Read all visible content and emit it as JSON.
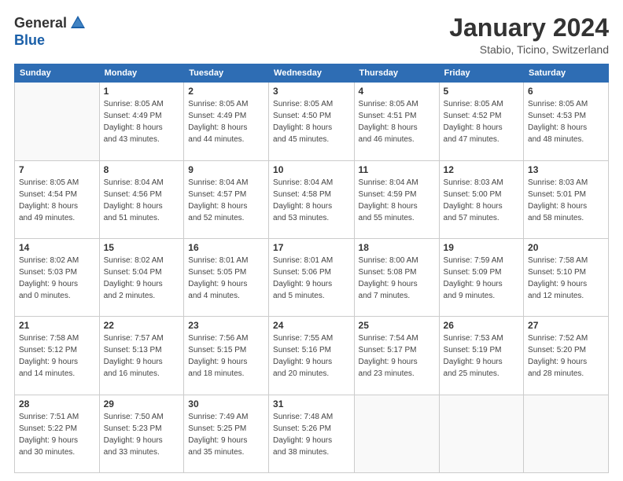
{
  "logo": {
    "general": "General",
    "blue": "Blue"
  },
  "title": "January 2024",
  "location": "Stabio, Ticino, Switzerland",
  "days_header": [
    "Sunday",
    "Monday",
    "Tuesday",
    "Wednesday",
    "Thursday",
    "Friday",
    "Saturday"
  ],
  "weeks": [
    [
      {
        "day": "",
        "info": ""
      },
      {
        "day": "1",
        "info": "Sunrise: 8:05 AM\nSunset: 4:49 PM\nDaylight: 8 hours\nand 43 minutes."
      },
      {
        "day": "2",
        "info": "Sunrise: 8:05 AM\nSunset: 4:49 PM\nDaylight: 8 hours\nand 44 minutes."
      },
      {
        "day": "3",
        "info": "Sunrise: 8:05 AM\nSunset: 4:50 PM\nDaylight: 8 hours\nand 45 minutes."
      },
      {
        "day": "4",
        "info": "Sunrise: 8:05 AM\nSunset: 4:51 PM\nDaylight: 8 hours\nand 46 minutes."
      },
      {
        "day": "5",
        "info": "Sunrise: 8:05 AM\nSunset: 4:52 PM\nDaylight: 8 hours\nand 47 minutes."
      },
      {
        "day": "6",
        "info": "Sunrise: 8:05 AM\nSunset: 4:53 PM\nDaylight: 8 hours\nand 48 minutes."
      }
    ],
    [
      {
        "day": "7",
        "info": "Sunrise: 8:05 AM\nSunset: 4:54 PM\nDaylight: 8 hours\nand 49 minutes."
      },
      {
        "day": "8",
        "info": "Sunrise: 8:04 AM\nSunset: 4:56 PM\nDaylight: 8 hours\nand 51 minutes."
      },
      {
        "day": "9",
        "info": "Sunrise: 8:04 AM\nSunset: 4:57 PM\nDaylight: 8 hours\nand 52 minutes."
      },
      {
        "day": "10",
        "info": "Sunrise: 8:04 AM\nSunset: 4:58 PM\nDaylight: 8 hours\nand 53 minutes."
      },
      {
        "day": "11",
        "info": "Sunrise: 8:04 AM\nSunset: 4:59 PM\nDaylight: 8 hours\nand 55 minutes."
      },
      {
        "day": "12",
        "info": "Sunrise: 8:03 AM\nSunset: 5:00 PM\nDaylight: 8 hours\nand 57 minutes."
      },
      {
        "day": "13",
        "info": "Sunrise: 8:03 AM\nSunset: 5:01 PM\nDaylight: 8 hours\nand 58 minutes."
      }
    ],
    [
      {
        "day": "14",
        "info": "Sunrise: 8:02 AM\nSunset: 5:03 PM\nDaylight: 9 hours\nand 0 minutes."
      },
      {
        "day": "15",
        "info": "Sunrise: 8:02 AM\nSunset: 5:04 PM\nDaylight: 9 hours\nand 2 minutes."
      },
      {
        "day": "16",
        "info": "Sunrise: 8:01 AM\nSunset: 5:05 PM\nDaylight: 9 hours\nand 4 minutes."
      },
      {
        "day": "17",
        "info": "Sunrise: 8:01 AM\nSunset: 5:06 PM\nDaylight: 9 hours\nand 5 minutes."
      },
      {
        "day": "18",
        "info": "Sunrise: 8:00 AM\nSunset: 5:08 PM\nDaylight: 9 hours\nand 7 minutes."
      },
      {
        "day": "19",
        "info": "Sunrise: 7:59 AM\nSunset: 5:09 PM\nDaylight: 9 hours\nand 9 minutes."
      },
      {
        "day": "20",
        "info": "Sunrise: 7:58 AM\nSunset: 5:10 PM\nDaylight: 9 hours\nand 12 minutes."
      }
    ],
    [
      {
        "day": "21",
        "info": "Sunrise: 7:58 AM\nSunset: 5:12 PM\nDaylight: 9 hours\nand 14 minutes."
      },
      {
        "day": "22",
        "info": "Sunrise: 7:57 AM\nSunset: 5:13 PM\nDaylight: 9 hours\nand 16 minutes."
      },
      {
        "day": "23",
        "info": "Sunrise: 7:56 AM\nSunset: 5:15 PM\nDaylight: 9 hours\nand 18 minutes."
      },
      {
        "day": "24",
        "info": "Sunrise: 7:55 AM\nSunset: 5:16 PM\nDaylight: 9 hours\nand 20 minutes."
      },
      {
        "day": "25",
        "info": "Sunrise: 7:54 AM\nSunset: 5:17 PM\nDaylight: 9 hours\nand 23 minutes."
      },
      {
        "day": "26",
        "info": "Sunrise: 7:53 AM\nSunset: 5:19 PM\nDaylight: 9 hours\nand 25 minutes."
      },
      {
        "day": "27",
        "info": "Sunrise: 7:52 AM\nSunset: 5:20 PM\nDaylight: 9 hours\nand 28 minutes."
      }
    ],
    [
      {
        "day": "28",
        "info": "Sunrise: 7:51 AM\nSunset: 5:22 PM\nDaylight: 9 hours\nand 30 minutes."
      },
      {
        "day": "29",
        "info": "Sunrise: 7:50 AM\nSunset: 5:23 PM\nDaylight: 9 hours\nand 33 minutes."
      },
      {
        "day": "30",
        "info": "Sunrise: 7:49 AM\nSunset: 5:25 PM\nDaylight: 9 hours\nand 35 minutes."
      },
      {
        "day": "31",
        "info": "Sunrise: 7:48 AM\nSunset: 5:26 PM\nDaylight: 9 hours\nand 38 minutes."
      },
      {
        "day": "",
        "info": ""
      },
      {
        "day": "",
        "info": ""
      },
      {
        "day": "",
        "info": ""
      }
    ]
  ]
}
